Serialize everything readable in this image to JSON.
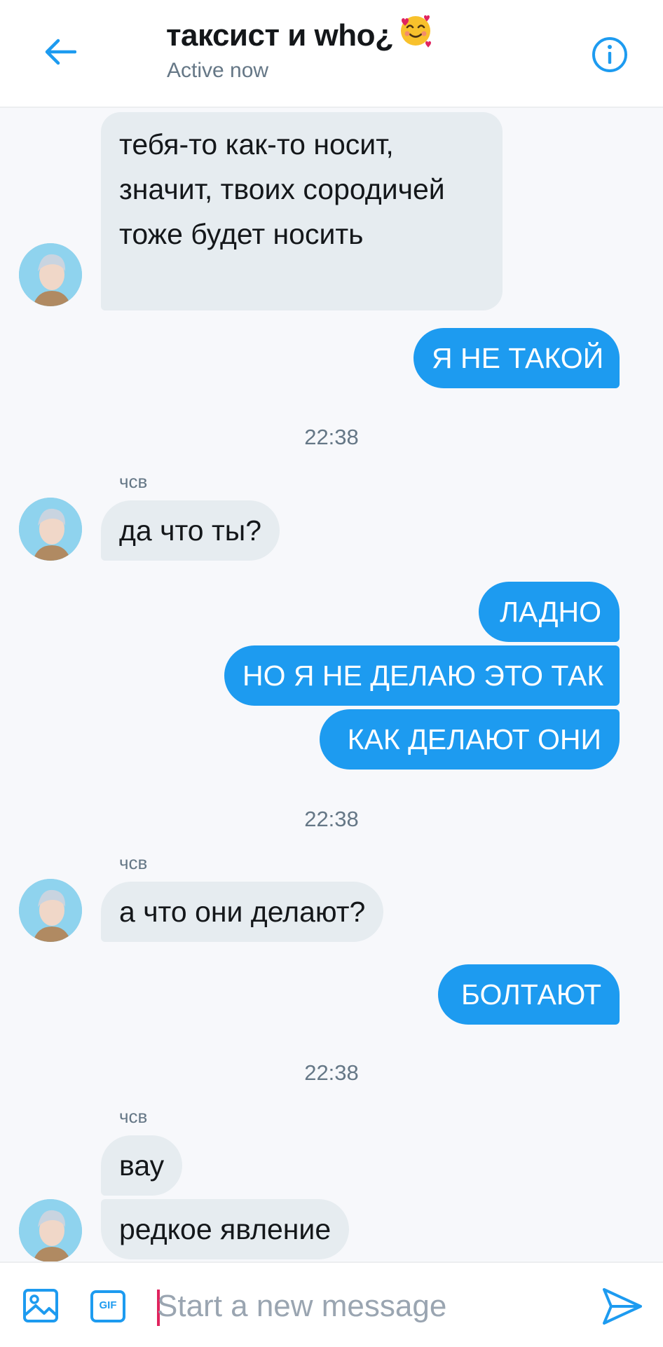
{
  "header": {
    "title": "таксист и who¿",
    "title_emoji": "smiling-face-with-hearts-icon",
    "status": "Active now"
  },
  "colors": {
    "accent": "#1d9bf0",
    "incoming_bubble": "#e6ecf0",
    "background": "#f7f8fb"
  },
  "messages": {
    "m1": "тебя-то как-то носит, значит, твоих сородичей тоже будет носить",
    "m2": "Я НЕ ТАКОЙ",
    "t1": "22:38",
    "s1": "чсв",
    "m3": "да что ты?",
    "m4": "ЛАДНО",
    "m5": "НО Я НЕ ДЕЛАЮ ЭТО ТАК",
    "m6": "КАК ДЕЛАЮТ ОНИ",
    "t2": "22:38",
    "s2": "чсв",
    "m7": "а что они делают?",
    "m8": "БОЛТАЮТ",
    "t3": "22:38",
    "s3": "чсв",
    "m9": "вау",
    "m10": "редкое явление"
  },
  "composer": {
    "placeholder": "Start a new message",
    "gif_label": "GIF"
  }
}
